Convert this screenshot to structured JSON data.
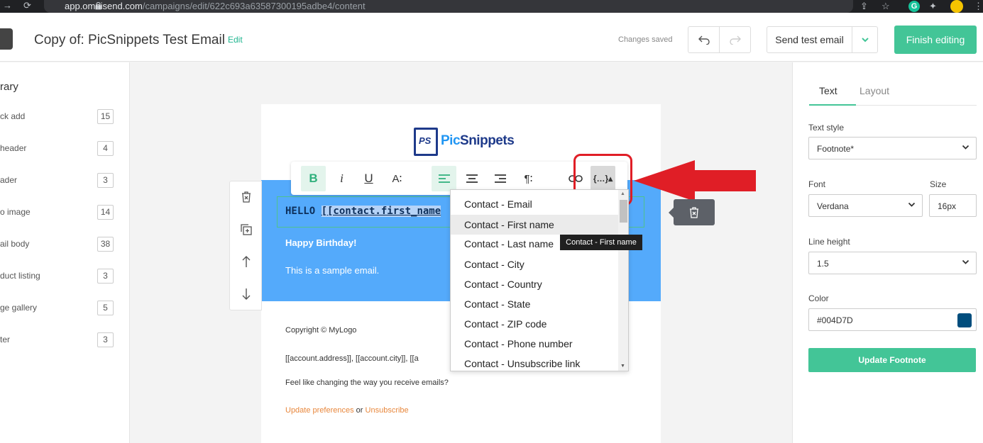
{
  "browser": {
    "url_host": "app.omnisend.com",
    "url_path": "/campaigns/edit/622c693a63587300195adbe4/content"
  },
  "header": {
    "title": "Copy of: PicSnippets Test Email",
    "edit_label": "Edit",
    "status": "Changes saved",
    "send_test_label": "Send test email",
    "finish_label": "Finish editing"
  },
  "sidebar": {
    "heading": "rary",
    "items": [
      {
        "label": "ck add",
        "count": "15"
      },
      {
        "label": "header",
        "count": "4"
      },
      {
        "label": "ader",
        "count": "3"
      },
      {
        "label": "o image",
        "count": "14"
      },
      {
        "label": "ail body",
        "count": "38"
      },
      {
        "label": "duct listing",
        "count": "3"
      },
      {
        "label": "ge gallery",
        "count": "5"
      },
      {
        "label": "ter",
        "count": "3"
      }
    ]
  },
  "email": {
    "brand_pic": "Pic",
    "brand_snippets": "Snippets",
    "brand_mark": "PS",
    "hello": "HELLO ",
    "hello_tag": "[[contact.first_name",
    "happy": "Happy Birthday!",
    "sample": "This is a sample email.",
    "copyright": "Copyright © MyLogo",
    "address": "[[account.address]], [[account.city]], [[a",
    "feel": "Feel like changing the way you receive emails?",
    "update_prefs": "Update preferences",
    "or": " or ",
    "unsubscribe": "Unsubscribe"
  },
  "toolbar": {
    "bold": "B",
    "italic": "i",
    "underline": "U",
    "font_size": "A∶",
    "para": "¶∶",
    "variables": "{…}▴"
  },
  "dropdown": {
    "items": [
      "Contact - Email",
      "Contact - First name",
      "Contact - Last name",
      "Contact - City",
      "Contact - Country",
      "Contact - State",
      "Contact - ZIP code",
      "Contact - Phone number",
      "Contact - Unsubscribe link"
    ],
    "tooltip": "Contact - First name"
  },
  "right_panel": {
    "tab_text": "Text",
    "tab_layout": "Layout",
    "text_style_label": "Text style",
    "text_style_value": "Footnote*",
    "font_label": "Font",
    "font_value": "Verdana",
    "size_label": "Size",
    "size_value": "16px",
    "line_height_label": "Line height",
    "line_height_value": "1.5",
    "color_label": "Color",
    "color_value": "#004D7D",
    "update_label": "Update Footnote"
  },
  "colors": {
    "accent": "#43c597",
    "block_bg": "#54aafb",
    "annotation_red": "#e01e26",
    "swatch": "#004d7d"
  }
}
